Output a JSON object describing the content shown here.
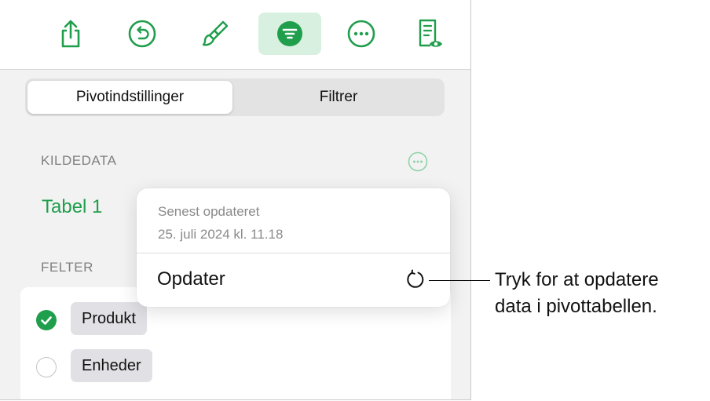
{
  "toolbar": {
    "icons": [
      "share-icon",
      "undo-icon",
      "paintbrush-icon",
      "organize-icon",
      "more-icon",
      "reader-view-icon"
    ],
    "accent": "#1f9e4c"
  },
  "tabs": [
    {
      "label": "Pivotindstillinger",
      "selected": true
    },
    {
      "label": "Filtrer",
      "selected": false
    }
  ],
  "source": {
    "section_label": "KILDEDATA",
    "table_name": "Tabel 1"
  },
  "fields": {
    "section_label": "FELTER",
    "items": [
      {
        "label": "Produkt",
        "checked": true
      },
      {
        "label": "Enheder",
        "checked": false
      }
    ]
  },
  "popover": {
    "label": "Senest opdateret",
    "date": "25. juli 2024 kl. 11.18",
    "action": "Opdater"
  },
  "callout": {
    "line1": "Tryk for at opdatere",
    "line2": "data i pivottabellen."
  }
}
